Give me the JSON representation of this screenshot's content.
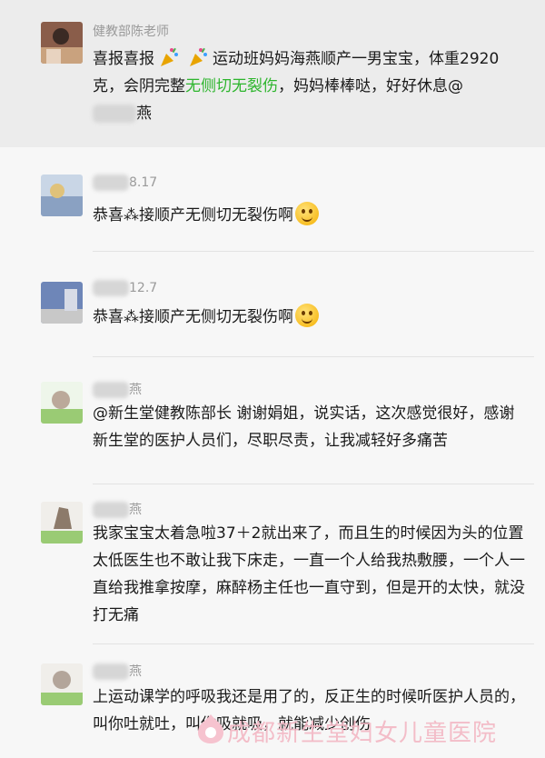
{
  "messages": [
    {
      "name": "健教部陈老师",
      "parts": [
        "喜报喜报",
        "运动班妈妈海燕顺产一男宝宝，体重2920克，会阴完整",
        "无侧切无裂伤",
        "，妈妈棒棒哒，好好休息@",
        "燕"
      ]
    },
    {
      "name_visible": "8.17",
      "text": "恭喜⁂接顺产无侧切无裂伤啊"
    },
    {
      "name_visible": "12.7",
      "text": "恭喜⁂接顺产无侧切无裂伤啊"
    },
    {
      "name_visible": "燕",
      "text": "@新生堂健教陈部长 谢谢娟姐，说实话，这次感觉很好，感谢新生堂的医护人员们，尽职尽责，让我减轻好多痛苦"
    },
    {
      "name_visible": "燕",
      "text": "我家宝宝太着急啦37＋2就出来了，而且生的时候因为头的位置太低医生也不敢让我下床走，一直一个人给我热敷腰，一个人一直给我推拿按摩，麻醉杨主任也一直守到，但是开的太快，就没打无痛"
    },
    {
      "name_visible": "燕",
      "text": "上运动课学的呼吸我还是用了的，反正生的时候听医护人员的，叫你吐就吐，叫你吸就吸，就能减少创伤"
    }
  ],
  "watermark": "成都新生堂妇女儿童医院",
  "colors": {
    "highlight": "#2db52d",
    "top_bg": "#ececec",
    "page_bg": "#f7f7f7"
  }
}
